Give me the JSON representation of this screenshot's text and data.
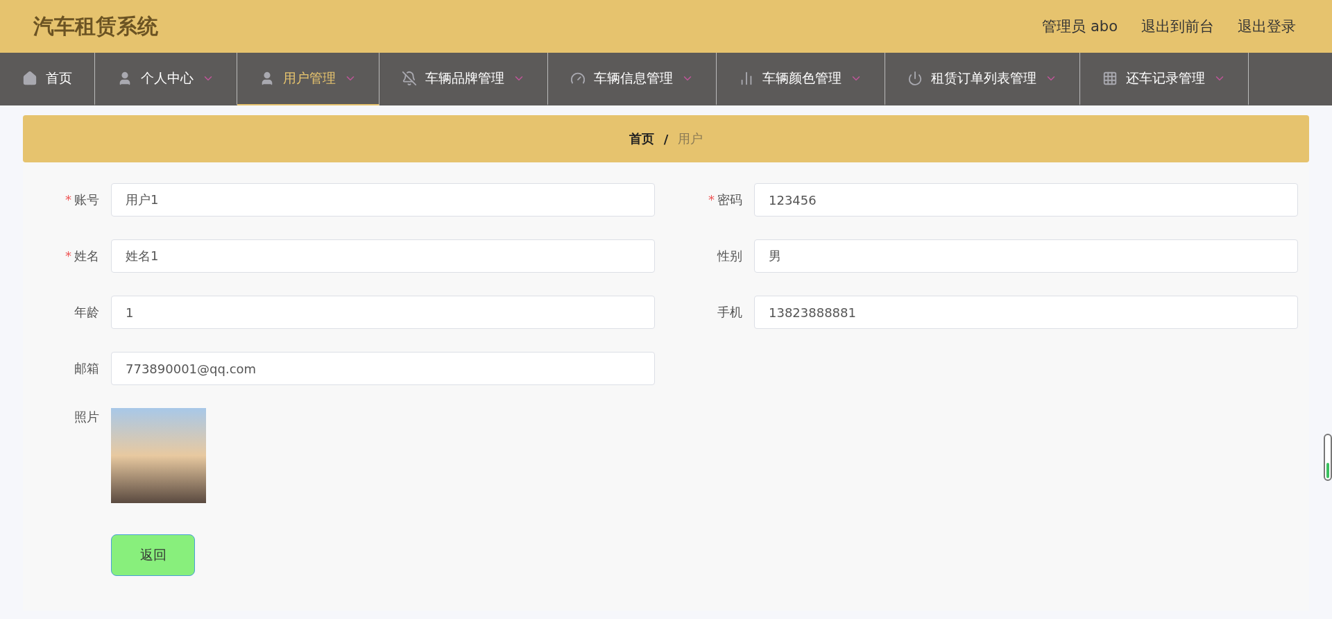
{
  "header": {
    "title": "汽车租赁系统",
    "links": [
      "管理员 abo",
      "退出到前台",
      "退出登录"
    ]
  },
  "nav": [
    {
      "label": "首页",
      "selected": false,
      "dropdown": false
    },
    {
      "label": "个人中心",
      "selected": false,
      "dropdown": true
    },
    {
      "label": "用户管理",
      "selected": true,
      "dropdown": true
    },
    {
      "label": "车辆品牌管理",
      "selected": false,
      "dropdown": true
    },
    {
      "label": "车辆信息管理",
      "selected": false,
      "dropdown": true
    },
    {
      "label": "车辆颜色管理",
      "selected": false,
      "dropdown": true
    },
    {
      "label": "租赁订单列表管理",
      "selected": false,
      "dropdown": true
    },
    {
      "label": "还车记录管理",
      "selected": false,
      "dropdown": true
    }
  ],
  "breadcrumb": {
    "items": [
      "首页",
      "用户"
    ],
    "separator": "/"
  },
  "form": {
    "rows": [
      [
        {
          "kind": "input",
          "required_mark": "*",
          "label": "账号",
          "value": "用户1"
        },
        {
          "kind": "input",
          "required_mark": "*",
          "label": "密码",
          "value": "123456"
        }
      ],
      [
        {
          "kind": "input",
          "required_mark": "*",
          "label": "姓名",
          "value": "姓名1"
        },
        {
          "kind": "input",
          "label": "性别",
          "value": "男"
        }
      ],
      [
        {
          "kind": "input",
          "label": "年龄",
          "value": "1"
        },
        {
          "kind": "input",
          "label": "手机",
          "value": "13823888881"
        }
      ],
      [
        {
          "kind": "input",
          "label": "邮箱",
          "value": "773890001@qq.com"
        }
      ],
      [
        {
          "kind": "image",
          "label": "照片"
        }
      ]
    ],
    "button": "返回"
  }
}
